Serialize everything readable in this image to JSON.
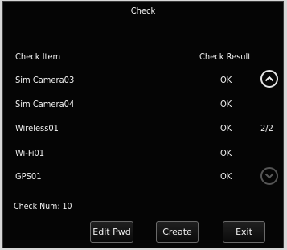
{
  "window": {
    "title": "Check"
  },
  "table": {
    "headers": {
      "item": "Check Item",
      "result": "Check Result"
    },
    "rows": [
      {
        "item": "Sim Camera03",
        "result": "OK"
      },
      {
        "item": "Sim Camera04",
        "result": "OK"
      },
      {
        "item": "Wireless01",
        "result": "OK"
      },
      {
        "item": "Wi-Fi01",
        "result": "OK"
      },
      {
        "item": "GPS01",
        "result": "OK"
      }
    ]
  },
  "pagination": {
    "indicator": "2/2",
    "up_icon": "chevron-up-icon",
    "down_icon": "chevron-down-icon"
  },
  "footer": {
    "check_num": "Check Num: 10"
  },
  "buttons": {
    "edit_pwd": "Edit Pwd",
    "create": "Create",
    "exit": "Exit"
  }
}
